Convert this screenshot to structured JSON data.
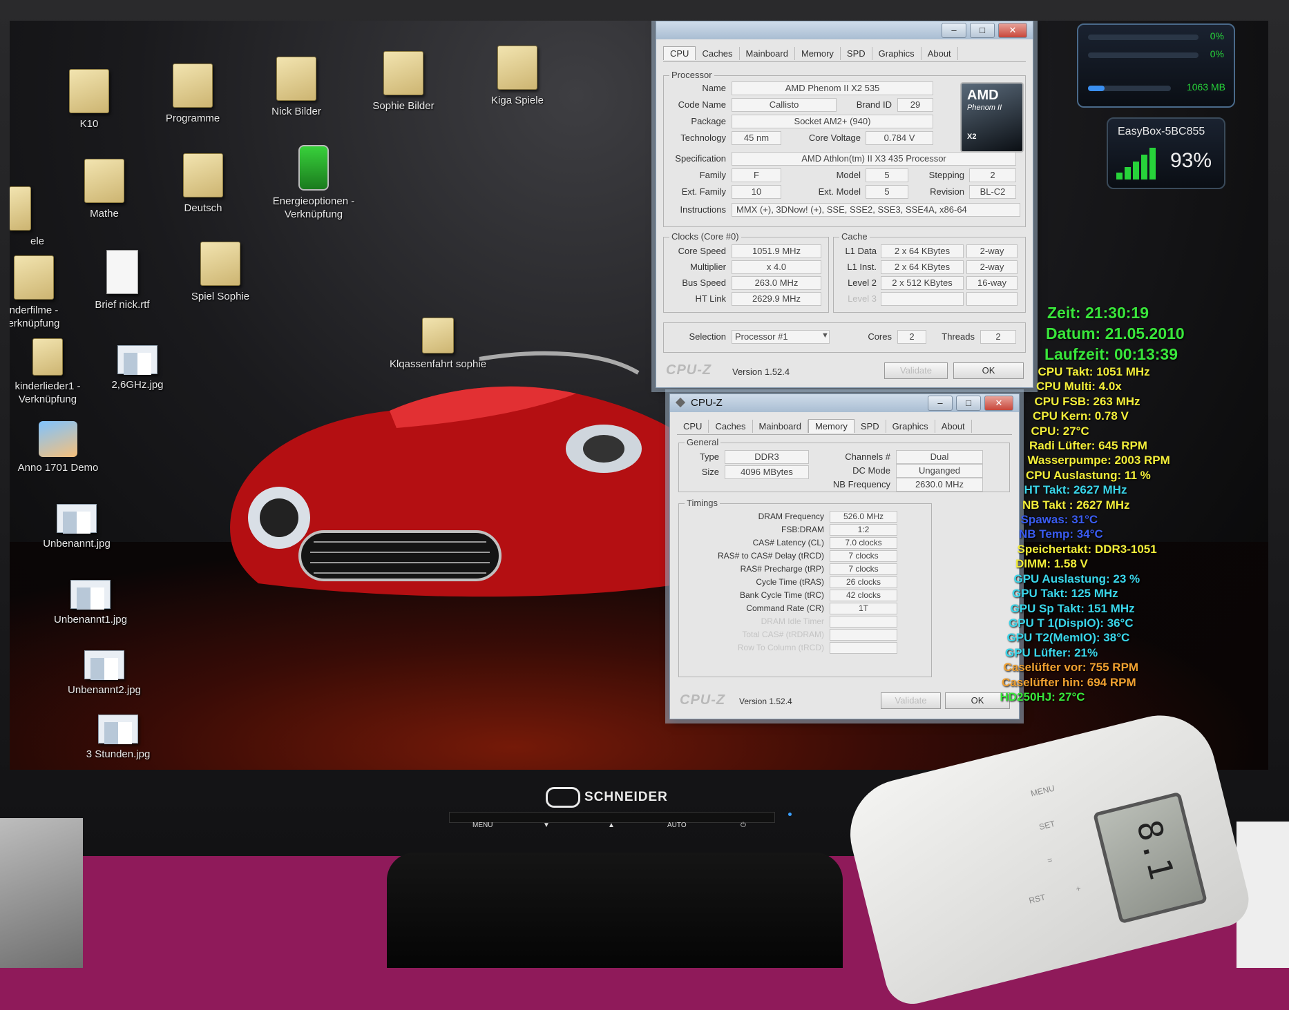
{
  "desktop": {
    "icons": [
      {
        "label": "K10",
        "kind": "folder"
      },
      {
        "label": "Programme",
        "kind": "folder"
      },
      {
        "label": "Nick Bilder",
        "kind": "folder"
      },
      {
        "label": "Sophie Bilder",
        "kind": "folder"
      },
      {
        "label": "Kiga Spiele",
        "kind": "folder"
      },
      {
        "label": "Mathe",
        "kind": "folder"
      },
      {
        "label": "Deutsch",
        "kind": "folder"
      },
      {
        "label": "Energieoptionen - Verknüpfung",
        "kind": "battery"
      },
      {
        "label": "Brief nick.rtf",
        "kind": "document"
      },
      {
        "label": "Spiel Sophie",
        "kind": "folder"
      },
      {
        "label": "nderfilme - erknüpfung",
        "kind": "folder"
      },
      {
        "label": "Klqassenfahrt sophie",
        "kind": "folder"
      },
      {
        "label": "kinderlieder1 - Verknüpfung",
        "kind": "folder"
      },
      {
        "label": "2,6GHz.jpg",
        "kind": "image"
      },
      {
        "label": "Anno 1701 Demo",
        "kind": "app"
      },
      {
        "label": "Unbenannt.jpg",
        "kind": "image"
      },
      {
        "label": "Unbenannt1.jpg",
        "kind": "image"
      },
      {
        "label": "Unbenannt2.jpg",
        "kind": "image"
      },
      {
        "label": "3 Stunden.jpg",
        "kind": "image"
      },
      {
        "label": "ele",
        "kind": "partial"
      }
    ]
  },
  "cpuz_cpu": {
    "tabs": [
      "CPU",
      "Caches",
      "Mainboard",
      "Memory",
      "SPD",
      "Graphics",
      "About"
    ],
    "active_tab": "CPU",
    "processor_group": "Processor",
    "name_label": "Name",
    "name": "AMD Phenom II X2 535",
    "code_name_label": "Code Name",
    "code_name": "Callisto",
    "brand_id_label": "Brand ID",
    "brand_id": "29",
    "package_label": "Package",
    "package": "Socket AM2+ (940)",
    "technology_label": "Technology",
    "technology": "45 nm",
    "core_voltage_label": "Core Voltage",
    "core_voltage": "0.784 V",
    "specification_label": "Specification",
    "specification": "AMD Athlon(tm) II X3 435 Processor",
    "family_label": "Family",
    "family": "F",
    "model_label": "Model",
    "model": "5",
    "stepping_label": "Stepping",
    "stepping": "2",
    "ext_family_label": "Ext. Family",
    "ext_family": "10",
    "ext_model_label": "Ext. Model",
    "ext_model": "5",
    "revision_label": "Revision",
    "revision": "BL-C2",
    "instructions_label": "Instructions",
    "instructions": "MMX (+), 3DNow! (+), SSE, SSE2, SSE3, SSE4A, x86-64",
    "clocks_group": "Clocks (Core #0)",
    "core_speed_label": "Core Speed",
    "core_speed": "1051.9 MHz",
    "multiplier_label": "Multiplier",
    "multiplier": "x 4.0",
    "bus_speed_label": "Bus Speed",
    "bus_speed": "263.0 MHz",
    "ht_link_label": "HT Link",
    "ht_link": "2629.9 MHz",
    "cache_group": "Cache",
    "l1_data_label": "L1 Data",
    "l1_data": "2 x 64 KBytes",
    "l1_data_way": "2-way",
    "l1_inst_label": "L1 Inst.",
    "l1_inst": "2 x 64 KBytes",
    "l1_inst_way": "2-way",
    "level2_label": "Level 2",
    "level2": "2 x 512 KBytes",
    "level2_way": "16-way",
    "level3_label": "Level 3",
    "selection_label": "Selection",
    "selection": "Processor #1",
    "cores_label": "Cores",
    "cores": "2",
    "threads_label": "Threads",
    "threads": "2",
    "logo": "CPU-Z",
    "version": "Version 1.52.4",
    "validate": "Validate",
    "ok": "OK",
    "amd_logo": "AMD",
    "amd_sub": "Phenom II",
    "amd_x2": "X2"
  },
  "cpuz_mem": {
    "title": "CPU-Z",
    "tabs": [
      "CPU",
      "Caches",
      "Mainboard",
      "Memory",
      "SPD",
      "Graphics",
      "About"
    ],
    "active_tab": "Memory",
    "general_group": "General",
    "type_label": "Type",
    "type": "DDR3",
    "size_label": "Size",
    "size": "4096 MBytes",
    "channels_label": "Channels #",
    "channels": "Dual",
    "dc_mode_label": "DC Mode",
    "dc_mode": "Unganged",
    "nb_freq_label": "NB Frequency",
    "nb_freq": "2630.0 MHz",
    "timings_group": "Timings",
    "timings": [
      {
        "label": "DRAM Frequency",
        "value": "526.0 MHz"
      },
      {
        "label": "FSB:DRAM",
        "value": "1:2"
      },
      {
        "label": "CAS# Latency (CL)",
        "value": "7.0 clocks"
      },
      {
        "label": "RAS# to CAS# Delay (tRCD)",
        "value": "7 clocks"
      },
      {
        "label": "RAS# Precharge (tRP)",
        "value": "7 clocks"
      },
      {
        "label": "Cycle Time (tRAS)",
        "value": "26 clocks"
      },
      {
        "label": "Bank Cycle Time (tRC)",
        "value": "42 clocks"
      },
      {
        "label": "Command Rate (CR)",
        "value": "1T"
      },
      {
        "label": "DRAM Idle Timer",
        "value": ""
      },
      {
        "label": "Total CAS# (tRDRAM)",
        "value": ""
      },
      {
        "label": "Row To Column (tRCD)",
        "value": ""
      }
    ],
    "logo": "CPU-Z",
    "version": "Version 1.52.4",
    "validate": "Validate",
    "ok": "OK"
  },
  "gadgets": {
    "meter": {
      "line1": "0%",
      "line2": "0%",
      "memory": "1063 MB",
      "colors": {
        "accent": "#27d33a"
      }
    },
    "wifi": {
      "ssid": "EasyBox-5BC855",
      "signal": "93%",
      "signal_level": 0.93
    }
  },
  "sensor_info": [
    {
      "text": "Zeit: 21:30:19",
      "color": "#39e63b",
      "big": true
    },
    {
      "text": "Datum: 21.05.2010",
      "color": "#39e63b",
      "big": true
    },
    {
      "text": "Laufzeit: 00:13:39",
      "color": "#39e63b",
      "big": true
    },
    {
      "text": "CPU Takt: 1051 MHz",
      "color": "#f3ee3a"
    },
    {
      "text": "CPU Multi: 4.0x",
      "color": "#f3ee3a"
    },
    {
      "text": "CPU FSB: 263 MHz",
      "color": "#f3ee3a"
    },
    {
      "text": "CPU Kern: 0.78 V",
      "color": "#f3ee3a"
    },
    {
      "text": "CPU: 27°C",
      "color": "#f3ee3a"
    },
    {
      "text": "Radi Lüfter: 645 RPM",
      "color": "#f3ee3a"
    },
    {
      "text": "Wasserpumpe: 2003 RPM",
      "color": "#f3ee3a"
    },
    {
      "text": "CPU Auslastung: 11 %",
      "color": "#f3ee3a"
    },
    {
      "text": "HT Takt: 2627 MHz",
      "color": "#3ad6ea"
    },
    {
      "text": "NB Takt : 2627 MHz",
      "color": "#f3ee3a"
    },
    {
      "text": "Spawas: 31°C",
      "color": "#3a5cf0"
    },
    {
      "text": "NB Temp: 34°C",
      "color": "#3a5cf0"
    },
    {
      "text": "Speichertakt: DDR3-1051",
      "color": "#f3ee3a"
    },
    {
      "text": "DIMM: 1.58 V",
      "color": "#f3ee3a"
    },
    {
      "text": "GPU Auslastung: 23 %",
      "color": "#3ad6ea"
    },
    {
      "text": "GPU Takt: 125 MHz",
      "color": "#3ad6ea"
    },
    {
      "text": "GPU Sp Takt: 151 MHz",
      "color": "#3ad6ea"
    },
    {
      "text": "GPU T 1(DispIO): 36°C",
      "color": "#3ad6ea"
    },
    {
      "text": "GPU T2(MemIO): 38°C",
      "color": "#3ad6ea"
    },
    {
      "text": "GPU Lüfter: 21%",
      "color": "#3ad6ea"
    },
    {
      "text": "Caselüfter vor: 755 RPM",
      "color": "#f0a030"
    },
    {
      "text": "Caselüfter hin: 694 RPM",
      "color": "#f0a030"
    },
    {
      "text": "HD250HJ: 27°C",
      "color": "#39e63b"
    }
  ],
  "monitor": {
    "brand": "SCHNEIDER",
    "controls": [
      "MENU",
      "▼",
      "▲",
      "AUTO",
      "⏻"
    ]
  },
  "plug_meter": {
    "buttons": [
      "MENU",
      "SET",
      "=",
      "+",
      "RST"
    ],
    "display": "8.1"
  }
}
